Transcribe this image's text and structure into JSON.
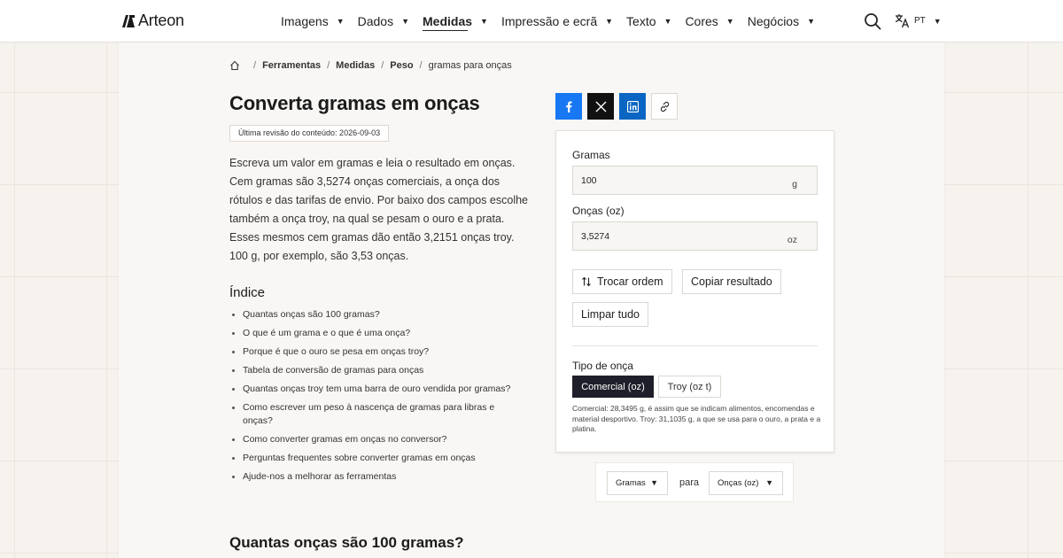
{
  "header": {
    "logo_text": "Arteon",
    "nav": [
      {
        "label": "Imagens"
      },
      {
        "label": "Dados"
      },
      {
        "label": "Medidas",
        "active": true
      },
      {
        "label": "Impressão e ecrã"
      },
      {
        "label": "Texto"
      },
      {
        "label": "Cores"
      },
      {
        "label": "Negócios"
      }
    ],
    "caret": "▼",
    "lang_label": "PT"
  },
  "breadcrumb": {
    "items": [
      "Ferramentas",
      "Medidas",
      "Peso"
    ],
    "current": "gramas para onças",
    "separator": "/"
  },
  "page": {
    "title": "Converta gramas em onças",
    "revised": "Última revisão do conteúdo: 2026-09-03",
    "intro": "Escreva um valor em gramas e leia o resultado em onças. Cem gramas são 3,5274 onças comerciais, a onça dos rótulos e das tarifas de envio. Por baixo dos campos escolhe também a onça troy, na qual se pesam o ouro e a prata. Esses mesmos cem gramas dão então 3,2151 onças troy. 100 g, por exemplo, são 3,53 onças.",
    "toc_title": "Índice",
    "toc": [
      "Quantas onças são 100 gramas?",
      "O que é um grama e o que é uma onça?",
      "Porque é que o ouro se pesa em onças troy?",
      "Tabela de conversão de gramas para onças",
      "Quantas onças troy tem uma barra de ouro vendida por gramas?",
      "Como escrever um peso à nascença de gramas para libras e onças?",
      "Como converter gramas em onças no conversor?",
      "Perguntas frequentes sobre converter gramas em onças",
      "Ajude-nos a melhorar as ferramentas"
    ],
    "section_heading": "Quantas onças são 100 gramas?"
  },
  "converter": {
    "input_label": "Gramas",
    "input_value": "100",
    "input_unit": "g",
    "output_label": "Onças (oz)",
    "output_value": "3,5274",
    "output_unit": "oz",
    "swap_label": "Trocar ordem",
    "copy_label": "Copiar resultado",
    "clear_label": "Limpar tudo",
    "ounce_type_label": "Tipo de onça",
    "option_commercial": "Comercial (oz)",
    "option_troy": "Troy (oz t)",
    "selected_option": "Comercial (oz)",
    "note": "Comercial: 28,3495 g, é assim que se indicam alimentos, encomendas e material desportivo. Troy: 31,1035 g, a que se usa para o ouro, a prata e a platina."
  },
  "unit_selector": {
    "from": "Gramas",
    "connector": "para",
    "to": "Onças (oz)"
  },
  "colors": {
    "facebook": "#1877f2",
    "x": "#111111",
    "linkedin": "#0a66c2",
    "segment_active": "#1f1f2b"
  }
}
